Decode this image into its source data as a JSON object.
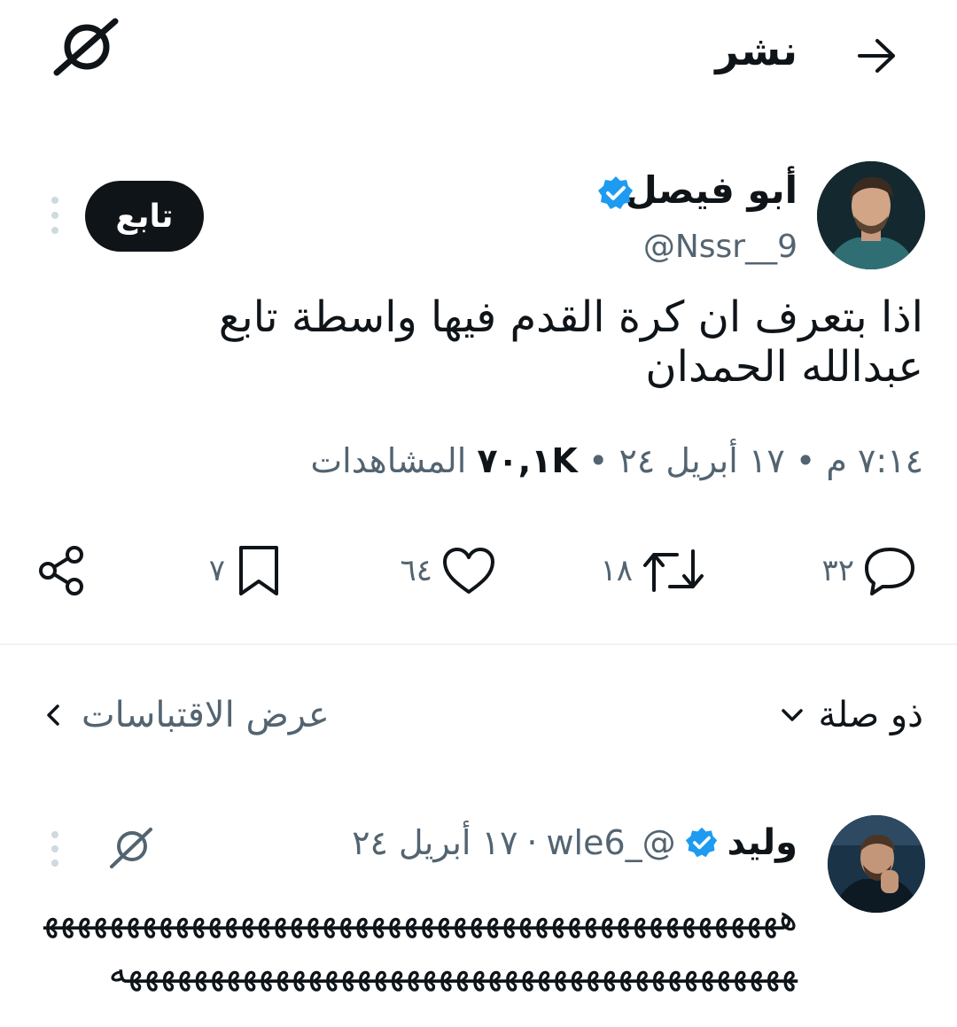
{
  "header": {
    "title": "نشر"
  },
  "tweet": {
    "author_name": "أبو فيصل",
    "handle": "@Nssr__9",
    "follow_label": "تابع",
    "text": "اذا بتعرف ان كرة القدم فيها واسطة تابع عبدالله الحمدان",
    "time": "٧:١٤ م",
    "date": "١٧ أبريل ٢٤",
    "views_count": "٧٠,١K",
    "views_label": "المشاهدات",
    "separator": "•"
  },
  "actions": {
    "replies": "٣٢",
    "retweets": "١٨",
    "likes": "٦٤",
    "bookmarks": "٧"
  },
  "sort": {
    "relevance_label": "ذو صلة",
    "quotes_label": "عرض الاقتباسات"
  },
  "reply": {
    "name": "وليد",
    "handle": "@_wle6",
    "separator": "·",
    "date": "١٧ أبريل ٢٤",
    "text": "هههههههههههههههههههههههههههههههههههههههههههههههههههههههههههههههههههههههههههههههههههههههه"
  },
  "colors": {
    "verified": "#1d9bf0",
    "text": "#0f1419",
    "secondary": "#536471",
    "follow_bg": "#0f1419"
  },
  "icons": [
    "back-arrow-icon",
    "grok-icon",
    "verified-icon",
    "more-vertical-icon",
    "reply-icon",
    "retweet-icon",
    "like-icon",
    "bookmark-icon",
    "share-icon",
    "chevron-down-icon",
    "chevron-left-icon"
  ]
}
